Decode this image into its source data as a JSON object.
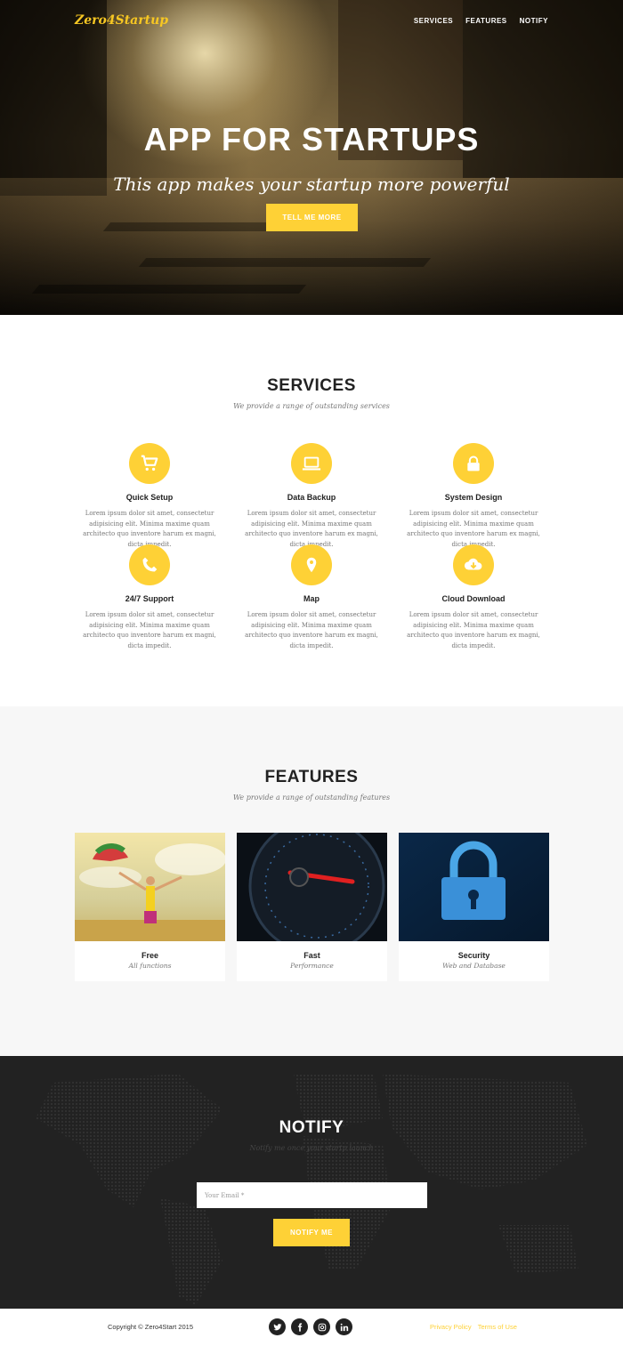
{
  "brand": {
    "logo": "Zero4Startup",
    "accent": "#fed136"
  },
  "nav": {
    "items": [
      "SERVICES",
      "FEATURES",
      "NOTIFY"
    ]
  },
  "hero": {
    "title": "APP FOR STARTUPS",
    "subtitle": "This app makes your startup more powerful",
    "button": "TELL ME MORE"
  },
  "services": {
    "title": "SERVICES",
    "subtitle": "We provide a range of outstanding services",
    "items": [
      {
        "icon": "cart-icon",
        "name": "Quick Setup",
        "desc": "Lorem ipsum dolor sit amet, consectetur adipisicing elit. Minima maxime quam architecto quo inventore harum ex magni, dicta impedit."
      },
      {
        "icon": "laptop-icon",
        "name": "Data Backup",
        "desc": "Lorem ipsum dolor sit amet, consectetur adipisicing elit. Minima maxime quam architecto quo inventore harum ex magni, dicta impedit."
      },
      {
        "icon": "lock-icon",
        "name": "System Design",
        "desc": "Lorem ipsum dolor sit amet, consectetur adipisicing elit. Minima maxime quam architecto quo inventore harum ex magni, dicta impedit."
      },
      {
        "icon": "phone-icon",
        "name": "24/7 Support",
        "desc": "Lorem ipsum dolor sit amet, consectetur adipisicing elit. Minima maxime quam architecto quo inventore harum ex magni, dicta impedit."
      },
      {
        "icon": "map-marker-icon",
        "name": "Map",
        "desc": "Lorem ipsum dolor sit amet, consectetur adipisicing elit. Minima maxime quam architecto quo inventore harum ex magni, dicta impedit."
      },
      {
        "icon": "cloud-download-icon",
        "name": "Cloud Download",
        "desc": "Lorem ipsum dolor sit amet, consectetur adipisicing elit. Minima maxime quam architecto quo inventore harum ex magni, dicta impedit."
      }
    ]
  },
  "features": {
    "title": "FEATURES",
    "subtitle": "We provide a range of outstanding features",
    "items": [
      {
        "title": "Free",
        "sub": "All functions"
      },
      {
        "title": "Fast",
        "sub": "Performance"
      },
      {
        "title": "Security",
        "sub": "Web and Database"
      }
    ]
  },
  "notify": {
    "title": "NOTIFY",
    "subtitle": "Notify me once your startp launch",
    "email_placeholder": "Your Email *",
    "button": "NOTIFY ME"
  },
  "footer": {
    "copyright": "Copyright © Zero4Start 2015",
    "socials": [
      "twitter-icon",
      "facebook-icon",
      "instagram-icon",
      "linkedin-icon"
    ],
    "links": [
      "Privacy Policy",
      "Terms of Use"
    ]
  }
}
